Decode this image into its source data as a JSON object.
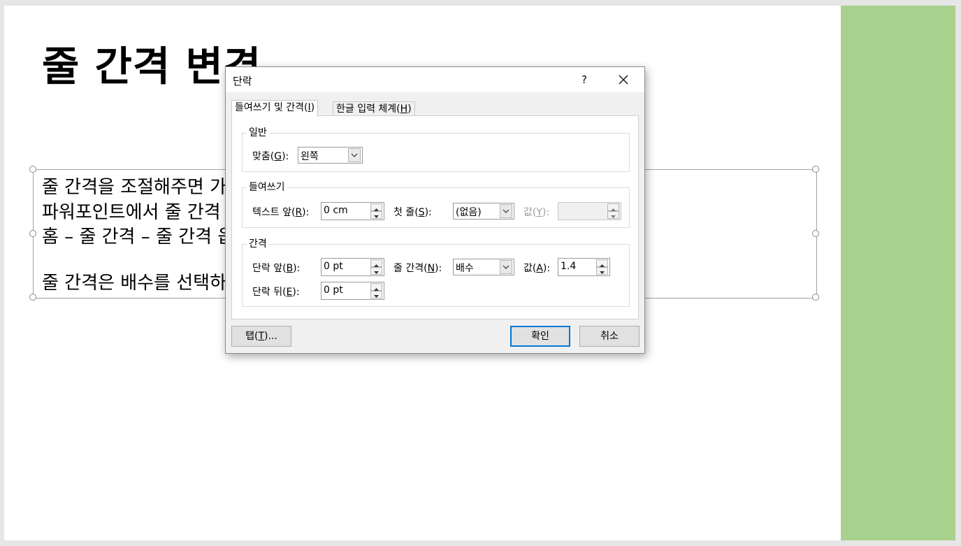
{
  "slide": {
    "title": "줄 간격 변경",
    "body_lines": [
      "줄 간격을 조절해주면 가",
      "파워포인트에서 줄 간격",
      "홈 – 줄 간격 – 줄 간격 옵",
      "",
      "줄 간격은 배수를 선택하"
    ]
  },
  "dialog": {
    "title": "단락",
    "help": "?",
    "tabs": [
      {
        "label": "들여쓰기 및 간격(",
        "key": "I",
        "suffix": ")"
      },
      {
        "label": "한글 입력 체계(",
        "key": "H",
        "suffix": ")"
      }
    ],
    "general": {
      "legend": "일반",
      "alignment_label": "맞춤(",
      "alignment_key": "G",
      "alignment_suffix": "):",
      "alignment_value": "왼쪽"
    },
    "indent": {
      "legend": "들여쓰기",
      "before_label": "텍스트 앞(",
      "before_key": "R",
      "before_suffix": "):",
      "before_value": "0 cm",
      "first_label": "첫 줄(",
      "first_key": "S",
      "first_suffix": "):",
      "first_value": "(없음)",
      "by_label": "값(",
      "by_key": "Y",
      "by_suffix": "):",
      "by_value": ""
    },
    "spacing": {
      "legend": "간격",
      "before_label": "단락 앞(",
      "before_key": "B",
      "before_suffix": "):",
      "before_value": "0 pt",
      "after_label": "단락 뒤(",
      "after_key": "E",
      "after_suffix": "):",
      "after_value": "0 pt",
      "line_label": "줄 간격(",
      "line_key": "N",
      "line_suffix": "):",
      "line_value": "배수",
      "at_label": "값(",
      "at_key": "A",
      "at_suffix": "):",
      "at_value": "1.4"
    },
    "buttons": {
      "tabs_label": "탭(",
      "tabs_key": "T",
      "tabs_suffix": ")...",
      "ok": "확인",
      "cancel": "취소"
    }
  }
}
